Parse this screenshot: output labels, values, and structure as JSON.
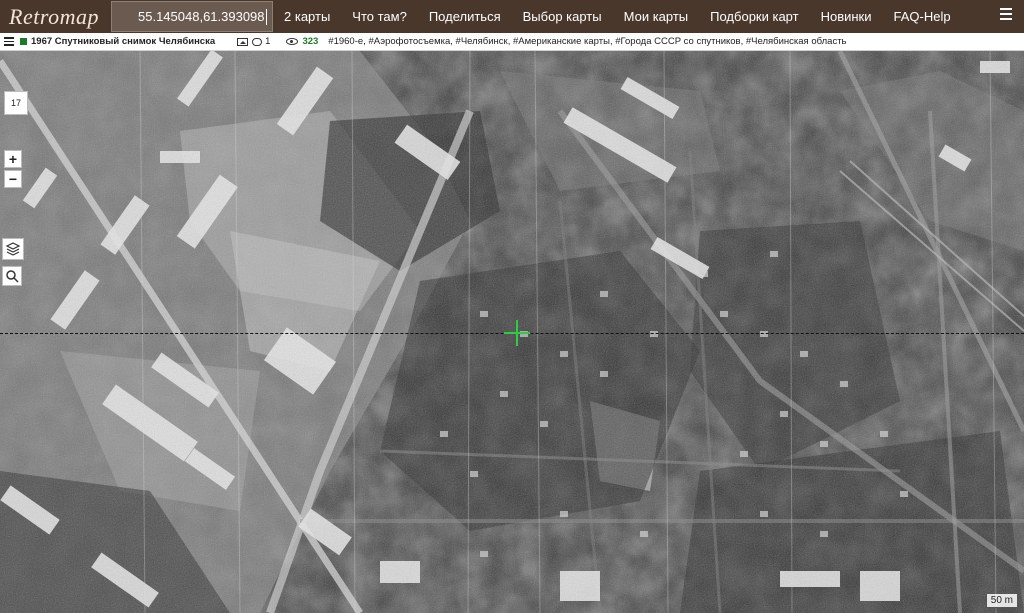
{
  "app": {
    "logo": "Retromap",
    "coordinates": "55.145048,61.393098"
  },
  "nav": {
    "items": [
      "2 карты",
      "Что там?",
      "Поделиться",
      "Выбор карты",
      "Мои карты",
      "Подборки карт",
      "Новинки",
      "FAQ-Help"
    ]
  },
  "info": {
    "map_title": "1967 Спутниковый снимок Челябинска",
    "comments_count": "1",
    "views_count": "323",
    "tags": "#1960-е, #Аэрофотосъемка, #Челябинск, #Американские карты, #Города СССР со спутников, #Челябинская область"
  },
  "controls": {
    "zoom_level": "17",
    "zoom_in": "+",
    "zoom_out": "−"
  },
  "scale": "50 m",
  "colors": {
    "topbar": "#4a372b",
    "accent_green": "#1e7a2a",
    "crosshair": "#2ecc40"
  },
  "icons": {
    "menu": "hamburger-icon",
    "image": "image-icon",
    "comment": "comment-icon",
    "views": "eye-icon",
    "layers": "layers-icon",
    "search": "search-icon",
    "crosshair": "crosshair-icon"
  }
}
